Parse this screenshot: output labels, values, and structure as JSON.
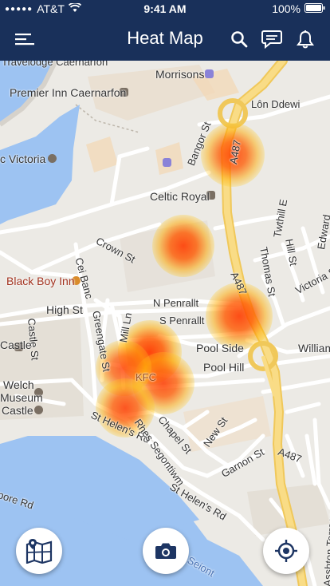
{
  "status": {
    "carrier": "AT&T",
    "time": "9:41 AM",
    "battery": "100%"
  },
  "nav": {
    "title": "Heat Map",
    "menu_icon": "menu-icon",
    "search_icon": "search-icon",
    "chat_icon": "chat-icon",
    "bell_icon": "bell-icon"
  },
  "map": {
    "places": {
      "travelodge": "Travelodge Caernarfon",
      "morrisons": "Morrisons",
      "lon_ddewi": "Lôn Ddewi",
      "premier_inn": "Premier Inn Caernarfon",
      "victoria": "c Victoria",
      "bangor_st": "Bangor St",
      "a487_top": "A487",
      "celtic_royal": "Celtic Royal",
      "twthill": "Twthill E",
      "edward": "Edward",
      "crown_st": "Crown St",
      "cei_banc": "Cei Banc",
      "thomas_st": "Thomas St",
      "hill_st": "Hill St",
      "victoria_st": "Victoria St",
      "black_boy_inn": "Black Boy Inn",
      "a487_mid": "A487",
      "high_st": "High St",
      "n_penrallt": "N Penrallt",
      "castle_st": "Castle St",
      "greengate_st": "Greengate St",
      "mill_ln": "Mill Ln",
      "s_penrallt": "S Penrallt",
      "pool_side": "Pool Side",
      "william": "William",
      "castle_left": "Castle",
      "pool_hill": "Pool Hill",
      "kfc": "KFC",
      "welch_museum_1": "Welch",
      "welch_museum_2": "Museum",
      "castle_museum": "Castle",
      "st_helens_rd": "St Helen's Rd",
      "rhes_segontiwm": "Rhes Segontiwm",
      "chapel_st": "Chapel St",
      "new_st": "New St",
      "garnon_st": "Garnon St",
      "a487_low": "A487",
      "st_helens_rd2": "St Helen's Rd",
      "pore_rd": "pore Rd",
      "seiont": "Seiont",
      "ashton_terrace": "Asshton Terrace"
    },
    "heatspots": [
      {
        "id": "bangor-st",
        "intensity": 0.9
      },
      {
        "id": "crown-st",
        "intensity": 0.95
      },
      {
        "id": "s-penrallt",
        "intensity": 0.95
      },
      {
        "id": "pool-side",
        "intensity": 1.0
      },
      {
        "id": "kfc",
        "intensity": 0.9
      },
      {
        "id": "greengate",
        "intensity": 0.85
      },
      {
        "id": "st-helens",
        "intensity": 0.9
      }
    ]
  },
  "buttons": {
    "map_toggle_icon": "map-pin-icon",
    "camera_icon": "camera-icon",
    "locate_icon": "crosshair-icon"
  },
  "colors": {
    "navbar": "#19305a",
    "water": "#9dc3f2",
    "road_major": "#f7d679",
    "heat_core": "#ff3c00",
    "poi_red": "#a2321e"
  }
}
